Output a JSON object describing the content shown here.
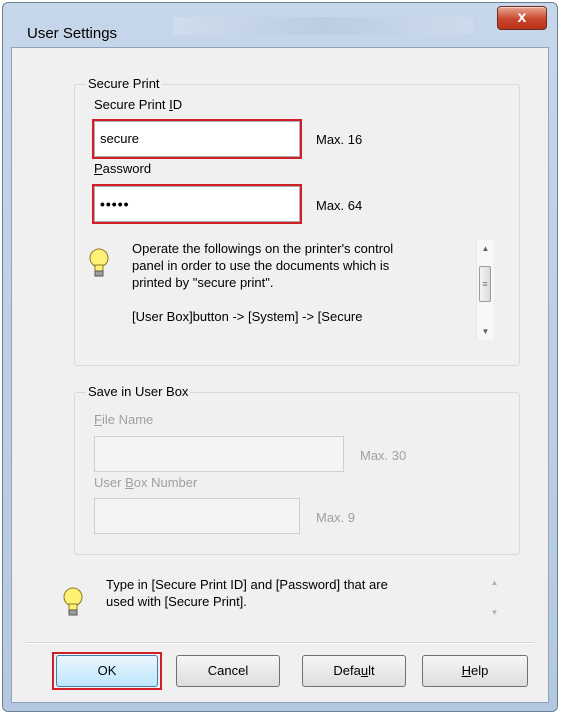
{
  "window": {
    "title": "User Settings",
    "close_symbol": "x"
  },
  "secure_print": {
    "group_title": "Secure Print",
    "id_label": "Secure Print ID",
    "id_label_accel": "I",
    "id_value": "secure",
    "id_max": "Max. 16",
    "password_label": "Password",
    "password_label_accel": "P",
    "password_value": "•••••",
    "password_max": "Max. 64",
    "info_lines": [
      "Operate the followings on the printer's control",
      "panel in order to use the documents which is",
      "printed by \"secure print\".",
      "",
      "[User Box]button -> [System] -> [Secure"
    ]
  },
  "user_box": {
    "group_title": "Save in User Box",
    "file_name_label": "File Name",
    "file_name_label_accel": "F",
    "file_name_value": "",
    "file_name_max": "Max. 30",
    "box_number_label": "User Box Number",
    "box_number_label_accel": "B",
    "box_number_value": "",
    "box_number_max": "Max. 9"
  },
  "hint": {
    "lines": [
      "Type in [Secure Print ID] and [Password] that are",
      "used with [Secure Print]."
    ]
  },
  "buttons": {
    "ok": "OK",
    "cancel": "Cancel",
    "default": "Default",
    "help": "Help"
  },
  "colors": {
    "highlight": "#d21e26",
    "titlebar": "#b9cce3",
    "close": "#c9462c"
  },
  "icons": [
    "lightbulb-icon",
    "close-icon",
    "scroll-up-icon",
    "scroll-down-icon"
  ]
}
